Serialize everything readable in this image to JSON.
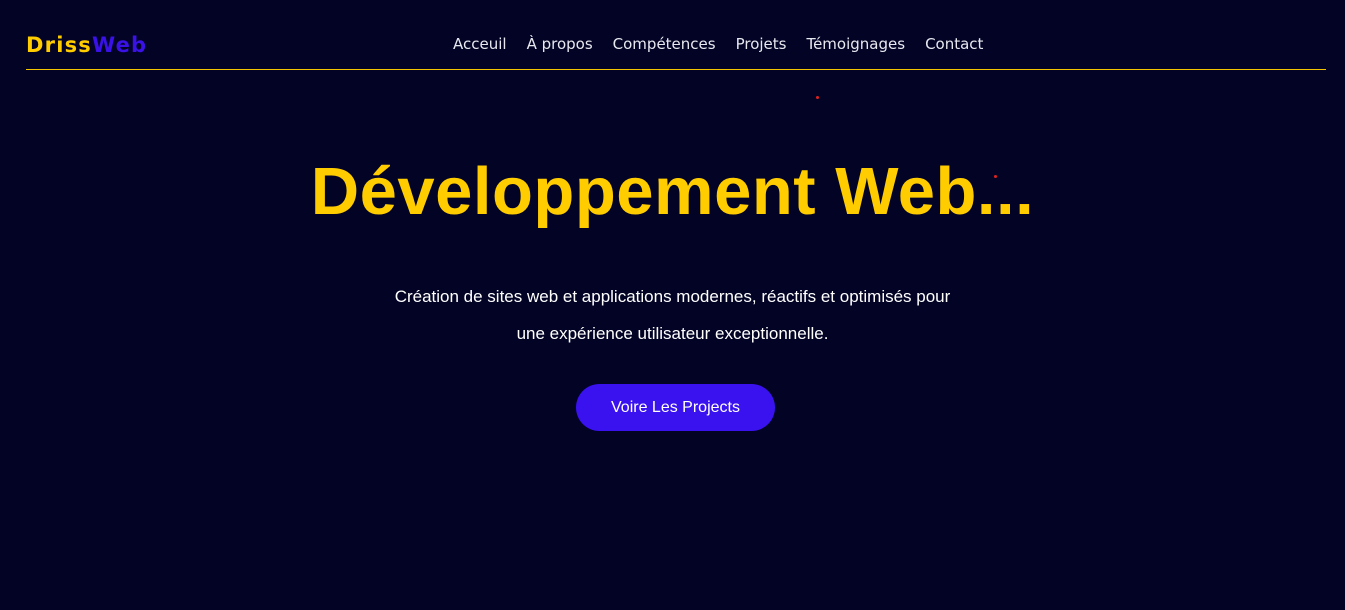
{
  "header": {
    "logo": {
      "part1": "Driss",
      "part2": "Web"
    },
    "nav": [
      {
        "label": "Acceuil"
      },
      {
        "label": "À propos"
      },
      {
        "label": "Compétences"
      },
      {
        "label": "Projets"
      },
      {
        "label": "Témoignages"
      },
      {
        "label": "Contact"
      }
    ]
  },
  "hero": {
    "title": "Développement Web...",
    "description_line1": "Création de sites web et applications modernes, réactifs et optimisés pour",
    "description_line2": "une expérience utilisateur exceptionnelle.",
    "cta_label": "Voire Les Projects"
  },
  "colors": {
    "background": "#020325",
    "accent_yellow": "#ffcc00",
    "accent_blue": "#3a12f0",
    "particle_red": "#e02020"
  }
}
